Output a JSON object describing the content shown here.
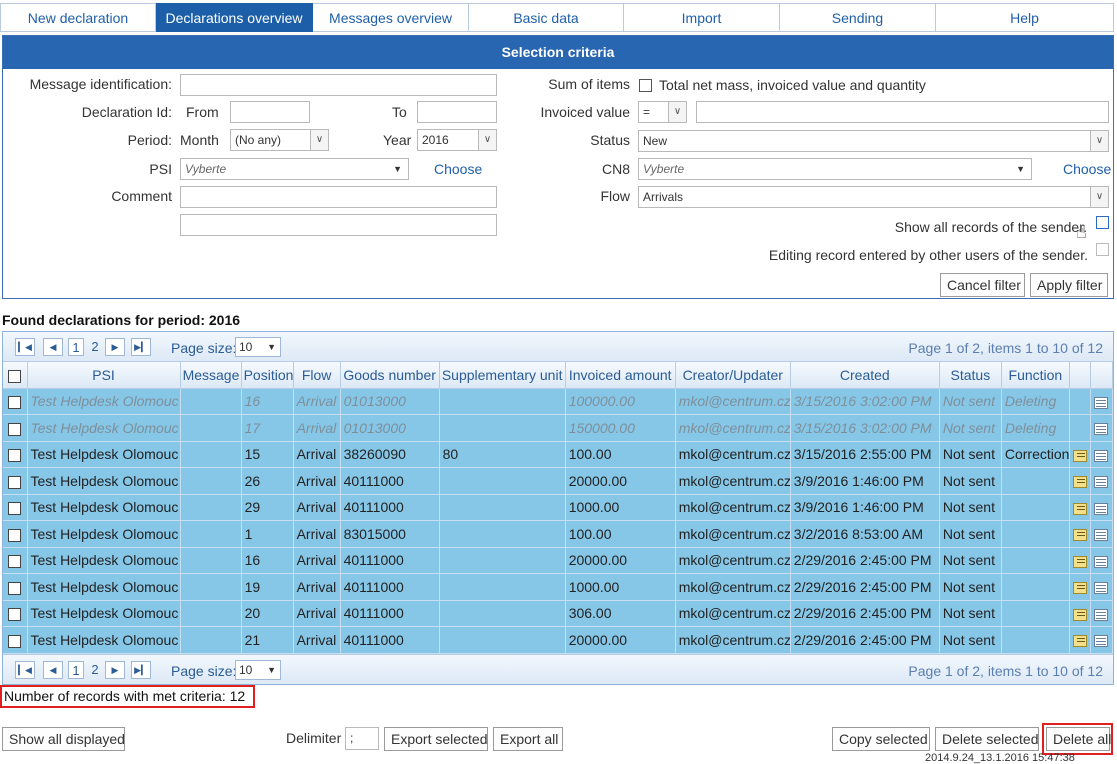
{
  "nav": {
    "tabs": [
      {
        "label": "New declaration"
      },
      {
        "label": "Declarations overview"
      },
      {
        "label": "Messages overview"
      },
      {
        "label": "Basic data"
      },
      {
        "label": "Import"
      },
      {
        "label": "Sending"
      },
      {
        "label": "Help"
      }
    ]
  },
  "selection": {
    "title": "Selection criteria",
    "message_id_label": "Message identification:",
    "message_id_value": "",
    "declaration_id_label": "Declaration Id:",
    "from_label": "From",
    "to_label": "To",
    "period_label": "Period:",
    "month_label": "Month",
    "month_value": "(No any)",
    "year_label": "Year",
    "year_value": "2016",
    "psi_label": "PSI",
    "psi_value": "Vyberte",
    "choose_label": "Choose",
    "comment_label": "Comment",
    "sum_items_label": "Sum of items",
    "sum_items_text": "Total net mass, invoiced value and quantity",
    "invoiced_value_label": "Invoiced value",
    "invoiced_op": "=",
    "status_label": "Status",
    "status_value": "New",
    "cn8_label": "CN8",
    "cn8_value": "Vyberte",
    "cn8_choose": "Choose",
    "flow_label": "Flow",
    "flow_value": "Arrivals",
    "show_all_label": "Show all records of the sender.",
    "editing_label": "Editing record entered by other users of the sender.",
    "cancel_filter": "Cancel filter",
    "apply_filter": "Apply filter"
  },
  "found_title": "Found declarations for period: 2016",
  "pager": {
    "page1": "1",
    "page2": "2",
    "page_size_label": "Page size:",
    "page_size": "10",
    "info": "Page 1 of 2, items 1 to 10 of 12"
  },
  "columns": [
    "PSI",
    "Message",
    "Position",
    "Flow",
    "Goods number",
    "Supplementary unit",
    "Invoiced amount",
    "Creator/Updater",
    "Created",
    "Status",
    "Function"
  ],
  "rows": [
    {
      "psi": "Test Helpdesk Olomouc",
      "message": "",
      "position": "16",
      "flow": "Arrival",
      "goods": "01013000",
      "supp": "",
      "amount": "100000.00",
      "creator": "mkol@centrum.cz",
      "created": "3/15/2016 3:02:00 PM",
      "status": "Not sent",
      "function": "Deleting",
      "dim": true,
      "edit": false
    },
    {
      "psi": "Test Helpdesk Olomouc",
      "message": "",
      "position": "17",
      "flow": "Arrival",
      "goods": "01013000",
      "supp": "",
      "amount": "150000.00",
      "creator": "mkol@centrum.cz",
      "created": "3/15/2016 3:02:00 PM",
      "status": "Not sent",
      "function": "Deleting",
      "dim": true,
      "edit": false
    },
    {
      "psi": "Test Helpdesk Olomouc",
      "message": "",
      "position": "15",
      "flow": "Arrival",
      "goods": "38260090",
      "supp": "80",
      "amount": "100.00",
      "creator": "mkol@centrum.cz",
      "created": "3/15/2016 2:55:00 PM",
      "status": "Not sent",
      "function": "Correction",
      "dim": false,
      "edit": true
    },
    {
      "psi": "Test Helpdesk Olomouc",
      "message": "",
      "position": "26",
      "flow": "Arrival",
      "goods": "40111000",
      "supp": "",
      "amount": "20000.00",
      "creator": "mkol@centrum.cz",
      "created": "3/9/2016 1:46:00 PM",
      "status": "Not sent",
      "function": "",
      "dim": false,
      "edit": true
    },
    {
      "psi": "Test Helpdesk Olomouc",
      "message": "",
      "position": "29",
      "flow": "Arrival",
      "goods": "40111000",
      "supp": "",
      "amount": "1000.00",
      "creator": "mkol@centrum.cz",
      "created": "3/9/2016 1:46:00 PM",
      "status": "Not sent",
      "function": "",
      "dim": false,
      "edit": true
    },
    {
      "psi": "Test Helpdesk Olomouc",
      "message": "",
      "position": "1",
      "flow": "Arrival",
      "goods": "83015000",
      "supp": "",
      "amount": "100.00",
      "creator": "mkol@centrum.cz",
      "created": "3/2/2016 8:53:00 AM",
      "status": "Not sent",
      "function": "",
      "dim": false,
      "edit": true
    },
    {
      "psi": "Test Helpdesk Olomouc",
      "message": "",
      "position": "16",
      "flow": "Arrival",
      "goods": "40111000",
      "supp": "",
      "amount": "20000.00",
      "creator": "mkol@centrum.cz",
      "created": "2/29/2016 2:45:00 PM",
      "status": "Not sent",
      "function": "",
      "dim": false,
      "edit": true
    },
    {
      "psi": "Test Helpdesk Olomouc",
      "message": "",
      "position": "19",
      "flow": "Arrival",
      "goods": "40111000",
      "supp": "",
      "amount": "1000.00",
      "creator": "mkol@centrum.cz",
      "created": "2/29/2016 2:45:00 PM",
      "status": "Not sent",
      "function": "",
      "dim": false,
      "edit": true
    },
    {
      "psi": "Test Helpdesk Olomouc",
      "message": "",
      "position": "20",
      "flow": "Arrival",
      "goods": "40111000",
      "supp": "",
      "amount": "306.00",
      "creator": "mkol@centrum.cz",
      "created": "2/29/2016 2:45:00 PM",
      "status": "Not sent",
      "function": "",
      "dim": false,
      "edit": true
    },
    {
      "psi": "Test Helpdesk Olomouc",
      "message": "",
      "position": "21",
      "flow": "Arrival",
      "goods": "40111000",
      "supp": "",
      "amount": "20000.00",
      "creator": "mkol@centrum.cz",
      "created": "2/29/2016 2:45:00 PM",
      "status": "Not sent",
      "function": "",
      "dim": false,
      "edit": true
    }
  ],
  "count_text": "Number of records with met criteria: 12",
  "actions": {
    "show_all_displayed": "Show all displayed",
    "delimiter_label": "Delimiter",
    "delimiter_value": ";",
    "export_selected": "Export selected",
    "export_all": "Export all",
    "copy_selected": "Copy selected",
    "delete_selected": "Delete selected",
    "delete_all": "Delete all"
  },
  "version": "2014.9.24_13.1.2016 15:47:38"
}
